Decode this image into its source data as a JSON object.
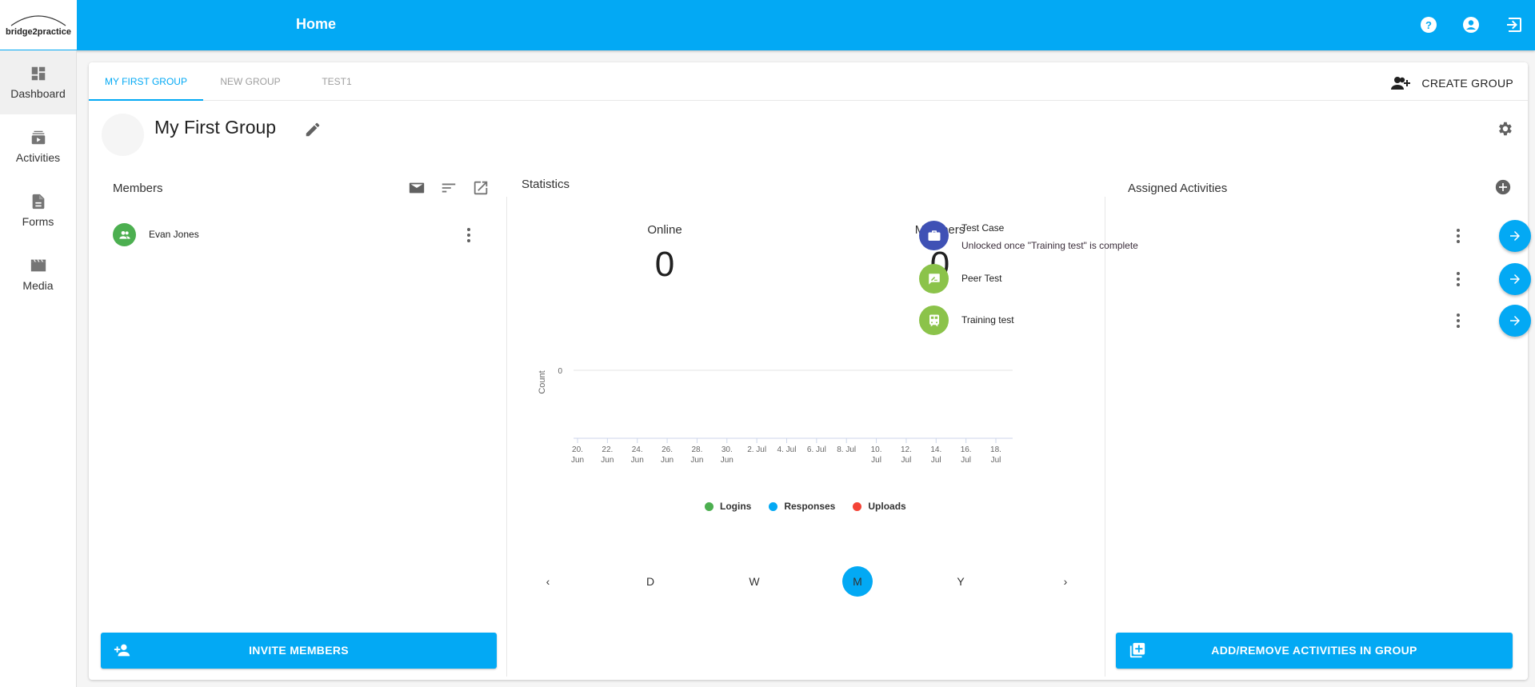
{
  "app": {
    "logo_text": "bridge2practice",
    "title": "Home",
    "header_icons": [
      "help-icon",
      "account-icon",
      "logout-icon"
    ]
  },
  "sidebar": {
    "items": [
      {
        "label": "Dashboard",
        "icon": "dashboard-icon",
        "active": true
      },
      {
        "label": "Activities",
        "icon": "activities-icon",
        "active": false
      },
      {
        "label": "Forms",
        "icon": "forms-icon",
        "active": false
      },
      {
        "label": "Media",
        "icon": "media-icon",
        "active": false
      }
    ]
  },
  "tabs": [
    {
      "label": "MY FIRST GROUP",
      "active": true
    },
    {
      "label": "NEW GROUP",
      "active": false
    },
    {
      "label": "TEST1",
      "active": false
    }
  ],
  "create_group_label": "CREATE GROUP",
  "group": {
    "name": "My First Group"
  },
  "members": {
    "title": "Members",
    "list": [
      {
        "name": "Evan Jones"
      }
    ],
    "invite_label": "INVITE MEMBERS"
  },
  "statistics": {
    "title": "Statistics",
    "online_label": "Online",
    "online_value": "0",
    "members_label": "Members",
    "members_value": "0",
    "periods": [
      "D",
      "W",
      "M",
      "Y"
    ],
    "active_period": "M",
    "prev_label": "‹",
    "next_label": "›"
  },
  "chart_data": {
    "type": "line",
    "title": "",
    "xlabel": "",
    "ylabel": "Count",
    "yticks": [
      "0"
    ],
    "ylim": [
      0,
      0
    ],
    "x_ticks": [
      "20. Jun",
      "22. Jun",
      "24. Jun",
      "26. Jun",
      "28. Jun",
      "30. Jun",
      "2. Jul",
      "4. Jul",
      "6. Jul",
      "8. Jul",
      "10. Jul",
      "12. Jul",
      "14. Jul",
      "16. Jul",
      "18. Jul"
    ],
    "series": [
      {
        "name": "Logins",
        "color": "#4caf50",
        "values": []
      },
      {
        "name": "Responses",
        "color": "#03a9f4",
        "values": []
      },
      {
        "name": "Uploads",
        "color": "#f44336",
        "values": []
      }
    ],
    "legend": "bottom",
    "grid": true
  },
  "activities": {
    "title": "Assigned Activities",
    "list": [
      {
        "title": "Test Case",
        "subtitle": "Unlocked once \"Training test\" is complete",
        "icon": "briefcase-icon",
        "color": "#3f51b5"
      },
      {
        "title": "Peer Test",
        "subtitle": "",
        "icon": "feedback-icon",
        "color": "#8bc34a"
      },
      {
        "title": "Training test",
        "subtitle": "",
        "icon": "train-icon",
        "color": "#8bc34a"
      }
    ],
    "add_remove_label": "ADD/REMOVE ACTIVITIES IN GROUP"
  },
  "colors": {
    "primary": "#03a9f4",
    "icon_grey": "#757575"
  }
}
